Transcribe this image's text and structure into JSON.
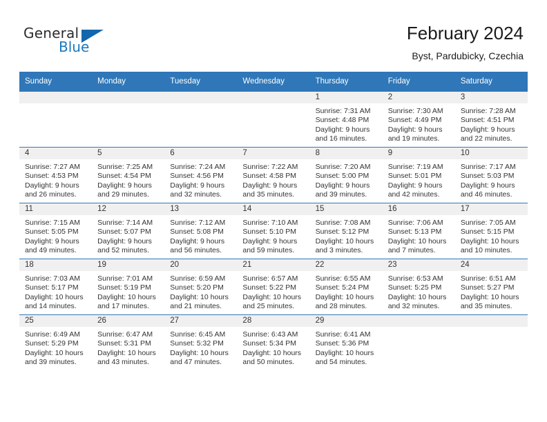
{
  "brand": {
    "name_top": "General",
    "name_bottom": "Blue",
    "triangle_icon": "triangle-icon",
    "color_primary": "#1267ad",
    "color_text": "#2b2b2b"
  },
  "header": {
    "title": "February 2024",
    "subtitle": "Byst, Pardubicky, Czechia"
  },
  "calendar": {
    "header_bg": "#2f77b8",
    "daynum_bg": "#f0f0f0",
    "weekday_headers": [
      "Sunday",
      "Monday",
      "Tuesday",
      "Wednesday",
      "Thursday",
      "Friday",
      "Saturday"
    ],
    "weeks": [
      [
        {
          "day": "",
          "sunrise": "",
          "sunset": "",
          "daylight_line1": "",
          "daylight_line2": "",
          "empty": true
        },
        {
          "day": "",
          "sunrise": "",
          "sunset": "",
          "daylight_line1": "",
          "daylight_line2": "",
          "empty": true
        },
        {
          "day": "",
          "sunrise": "",
          "sunset": "",
          "daylight_line1": "",
          "daylight_line2": "",
          "empty": true
        },
        {
          "day": "",
          "sunrise": "",
          "sunset": "",
          "daylight_line1": "",
          "daylight_line2": "",
          "empty": true
        },
        {
          "day": "1",
          "sunrise": "Sunrise: 7:31 AM",
          "sunset": "Sunset: 4:48 PM",
          "daylight_line1": "Daylight: 9 hours",
          "daylight_line2": "and 16 minutes.",
          "empty": false
        },
        {
          "day": "2",
          "sunrise": "Sunrise: 7:30 AM",
          "sunset": "Sunset: 4:49 PM",
          "daylight_line1": "Daylight: 9 hours",
          "daylight_line2": "and 19 minutes.",
          "empty": false
        },
        {
          "day": "3",
          "sunrise": "Sunrise: 7:28 AM",
          "sunset": "Sunset: 4:51 PM",
          "daylight_line1": "Daylight: 9 hours",
          "daylight_line2": "and 22 minutes.",
          "empty": false
        }
      ],
      [
        {
          "day": "4",
          "sunrise": "Sunrise: 7:27 AM",
          "sunset": "Sunset: 4:53 PM",
          "daylight_line1": "Daylight: 9 hours",
          "daylight_line2": "and 26 minutes.",
          "empty": false
        },
        {
          "day": "5",
          "sunrise": "Sunrise: 7:25 AM",
          "sunset": "Sunset: 4:54 PM",
          "daylight_line1": "Daylight: 9 hours",
          "daylight_line2": "and 29 minutes.",
          "empty": false
        },
        {
          "day": "6",
          "sunrise": "Sunrise: 7:24 AM",
          "sunset": "Sunset: 4:56 PM",
          "daylight_line1": "Daylight: 9 hours",
          "daylight_line2": "and 32 minutes.",
          "empty": false
        },
        {
          "day": "7",
          "sunrise": "Sunrise: 7:22 AM",
          "sunset": "Sunset: 4:58 PM",
          "daylight_line1": "Daylight: 9 hours",
          "daylight_line2": "and 35 minutes.",
          "empty": false
        },
        {
          "day": "8",
          "sunrise": "Sunrise: 7:20 AM",
          "sunset": "Sunset: 5:00 PM",
          "daylight_line1": "Daylight: 9 hours",
          "daylight_line2": "and 39 minutes.",
          "empty": false
        },
        {
          "day": "9",
          "sunrise": "Sunrise: 7:19 AM",
          "sunset": "Sunset: 5:01 PM",
          "daylight_line1": "Daylight: 9 hours",
          "daylight_line2": "and 42 minutes.",
          "empty": false
        },
        {
          "day": "10",
          "sunrise": "Sunrise: 7:17 AM",
          "sunset": "Sunset: 5:03 PM",
          "daylight_line1": "Daylight: 9 hours",
          "daylight_line2": "and 46 minutes.",
          "empty": false
        }
      ],
      [
        {
          "day": "11",
          "sunrise": "Sunrise: 7:15 AM",
          "sunset": "Sunset: 5:05 PM",
          "daylight_line1": "Daylight: 9 hours",
          "daylight_line2": "and 49 minutes.",
          "empty": false
        },
        {
          "day": "12",
          "sunrise": "Sunrise: 7:14 AM",
          "sunset": "Sunset: 5:07 PM",
          "daylight_line1": "Daylight: 9 hours",
          "daylight_line2": "and 52 minutes.",
          "empty": false
        },
        {
          "day": "13",
          "sunrise": "Sunrise: 7:12 AM",
          "sunset": "Sunset: 5:08 PM",
          "daylight_line1": "Daylight: 9 hours",
          "daylight_line2": "and 56 minutes.",
          "empty": false
        },
        {
          "day": "14",
          "sunrise": "Sunrise: 7:10 AM",
          "sunset": "Sunset: 5:10 PM",
          "daylight_line1": "Daylight: 9 hours",
          "daylight_line2": "and 59 minutes.",
          "empty": false
        },
        {
          "day": "15",
          "sunrise": "Sunrise: 7:08 AM",
          "sunset": "Sunset: 5:12 PM",
          "daylight_line1": "Daylight: 10 hours",
          "daylight_line2": "and 3 minutes.",
          "empty": false
        },
        {
          "day": "16",
          "sunrise": "Sunrise: 7:06 AM",
          "sunset": "Sunset: 5:13 PM",
          "daylight_line1": "Daylight: 10 hours",
          "daylight_line2": "and 7 minutes.",
          "empty": false
        },
        {
          "day": "17",
          "sunrise": "Sunrise: 7:05 AM",
          "sunset": "Sunset: 5:15 PM",
          "daylight_line1": "Daylight: 10 hours",
          "daylight_line2": "and 10 minutes.",
          "empty": false
        }
      ],
      [
        {
          "day": "18",
          "sunrise": "Sunrise: 7:03 AM",
          "sunset": "Sunset: 5:17 PM",
          "daylight_line1": "Daylight: 10 hours",
          "daylight_line2": "and 14 minutes.",
          "empty": false
        },
        {
          "day": "19",
          "sunrise": "Sunrise: 7:01 AM",
          "sunset": "Sunset: 5:19 PM",
          "daylight_line1": "Daylight: 10 hours",
          "daylight_line2": "and 17 minutes.",
          "empty": false
        },
        {
          "day": "20",
          "sunrise": "Sunrise: 6:59 AM",
          "sunset": "Sunset: 5:20 PM",
          "daylight_line1": "Daylight: 10 hours",
          "daylight_line2": "and 21 minutes.",
          "empty": false
        },
        {
          "day": "21",
          "sunrise": "Sunrise: 6:57 AM",
          "sunset": "Sunset: 5:22 PM",
          "daylight_line1": "Daylight: 10 hours",
          "daylight_line2": "and 25 minutes.",
          "empty": false
        },
        {
          "day": "22",
          "sunrise": "Sunrise: 6:55 AM",
          "sunset": "Sunset: 5:24 PM",
          "daylight_line1": "Daylight: 10 hours",
          "daylight_line2": "and 28 minutes.",
          "empty": false
        },
        {
          "day": "23",
          "sunrise": "Sunrise: 6:53 AM",
          "sunset": "Sunset: 5:25 PM",
          "daylight_line1": "Daylight: 10 hours",
          "daylight_line2": "and 32 minutes.",
          "empty": false
        },
        {
          "day": "24",
          "sunrise": "Sunrise: 6:51 AM",
          "sunset": "Sunset: 5:27 PM",
          "daylight_line1": "Daylight: 10 hours",
          "daylight_line2": "and 35 minutes.",
          "empty": false
        }
      ],
      [
        {
          "day": "25",
          "sunrise": "Sunrise: 6:49 AM",
          "sunset": "Sunset: 5:29 PM",
          "daylight_line1": "Daylight: 10 hours",
          "daylight_line2": "and 39 minutes.",
          "empty": false
        },
        {
          "day": "26",
          "sunrise": "Sunrise: 6:47 AM",
          "sunset": "Sunset: 5:31 PM",
          "daylight_line1": "Daylight: 10 hours",
          "daylight_line2": "and 43 minutes.",
          "empty": false
        },
        {
          "day": "27",
          "sunrise": "Sunrise: 6:45 AM",
          "sunset": "Sunset: 5:32 PM",
          "daylight_line1": "Daylight: 10 hours",
          "daylight_line2": "and 47 minutes.",
          "empty": false
        },
        {
          "day": "28",
          "sunrise": "Sunrise: 6:43 AM",
          "sunset": "Sunset: 5:34 PM",
          "daylight_line1": "Daylight: 10 hours",
          "daylight_line2": "and 50 minutes.",
          "empty": false
        },
        {
          "day": "29",
          "sunrise": "Sunrise: 6:41 AM",
          "sunset": "Sunset: 5:36 PM",
          "daylight_line1": "Daylight: 10 hours",
          "daylight_line2": "and 54 minutes.",
          "empty": false
        },
        {
          "day": "",
          "sunrise": "",
          "sunset": "",
          "daylight_line1": "",
          "daylight_line2": "",
          "empty": true
        },
        {
          "day": "",
          "sunrise": "",
          "sunset": "",
          "daylight_line1": "",
          "daylight_line2": "",
          "empty": true
        }
      ]
    ]
  }
}
